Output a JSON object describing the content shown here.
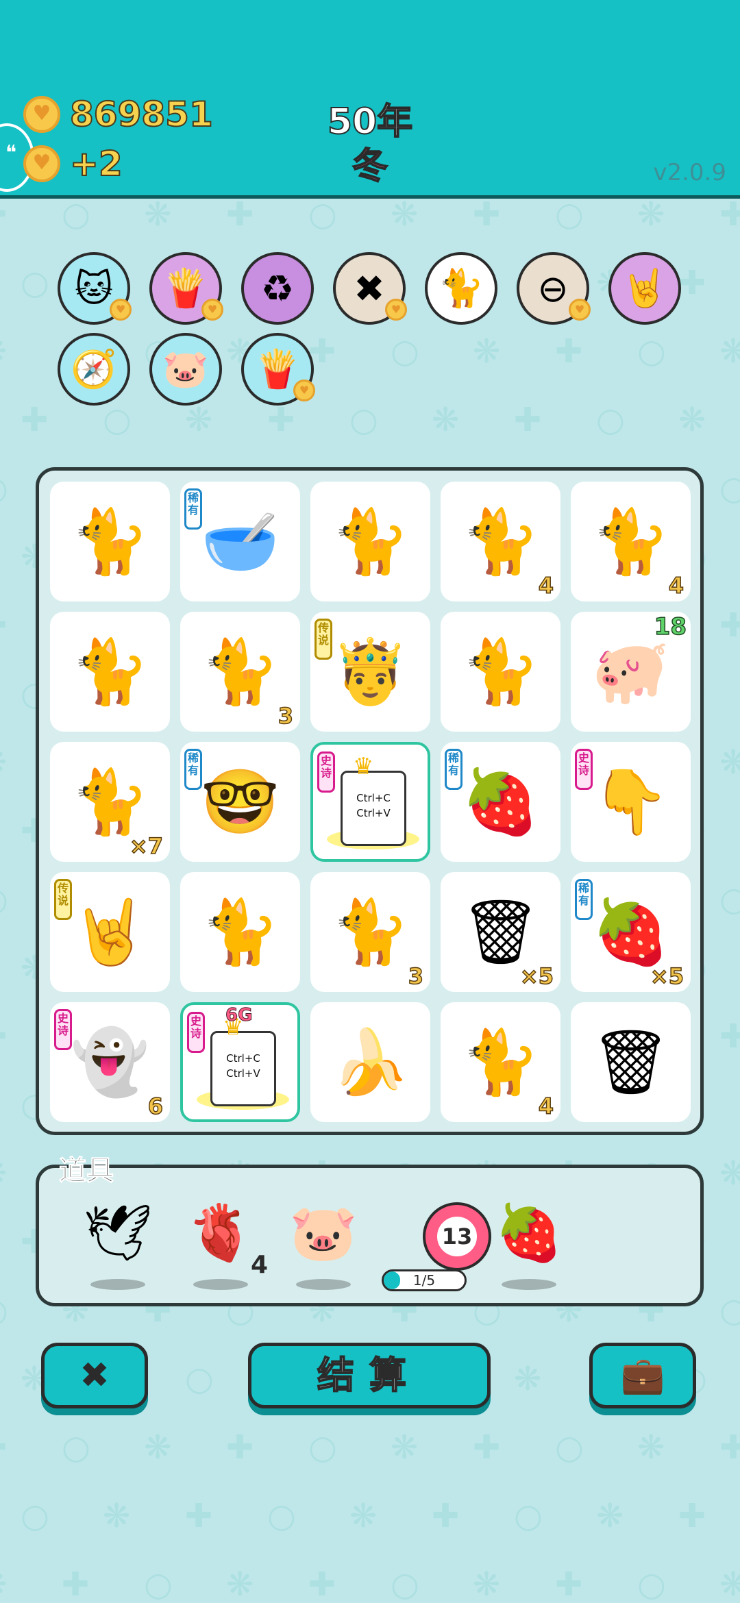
{
  "header": {
    "coins": "869851",
    "income": "+2",
    "year": "50年",
    "season": "冬",
    "version": "v2.0.9"
  },
  "skills": [
    {
      "icon": "cat-hole-icon",
      "glyph": "🐱",
      "bg": "#a6e9f2"
    },
    {
      "icon": "fries-icon",
      "glyph": "🍟",
      "bg": "#d9a3e6"
    },
    {
      "icon": "recycle-icon",
      "glyph": "♻",
      "bg": "#c88ee0"
    },
    {
      "icon": "delete-tag-icon",
      "glyph": "✖",
      "bg": "#eadfcf"
    },
    {
      "icon": "two-cats-icon",
      "glyph": "🐈",
      "bg": "#ffffff"
    },
    {
      "icon": "minus-icon",
      "glyph": "⊖",
      "bg": "#eadfcf"
    },
    {
      "icon": "rock-hand-icon",
      "glyph": "🤘",
      "bg": "#d9a3e6"
    },
    {
      "icon": "compass-icon",
      "glyph": "🧭",
      "bg": "#a6e9f2"
    },
    {
      "icon": "piggy-bank-icon",
      "glyph": "🐷",
      "bg": "#a6e9f2"
    },
    {
      "icon": "fries-icon",
      "glyph": "🍟",
      "bg": "#a6e9f2"
    }
  ],
  "board": [
    {
      "icon": "cat-icon",
      "glyph": "🐈",
      "count": ""
    },
    {
      "icon": "capsule-bowl-icon",
      "glyph": "🥣",
      "tag": "稀有",
      "tag_type": "rare",
      "count": ""
    },
    {
      "icon": "cat-icon",
      "glyph": "🐈",
      "count": ""
    },
    {
      "icon": "cat-icon",
      "glyph": "🐈",
      "count": "4"
    },
    {
      "icon": "cat-icon",
      "glyph": "🐈",
      "count": "4"
    },
    {
      "icon": "cat-icon",
      "glyph": "🐈",
      "count": ""
    },
    {
      "icon": "cat-icon",
      "glyph": "🐈",
      "count": "3"
    },
    {
      "icon": "king-face-icon",
      "glyph": "🤴",
      "tag": "传说",
      "tag_type": "legend",
      "count": ""
    },
    {
      "icon": "cat-icon",
      "glyph": "🐈",
      "count": ""
    },
    {
      "icon": "pig-icon",
      "glyph": "🐖",
      "count": "",
      "topcount": "18"
    },
    {
      "icon": "cat-icon",
      "glyph": "🐈",
      "count": "×7"
    },
    {
      "icon": "nerd-face-icon",
      "glyph": "🤓",
      "tag": "稀有",
      "tag_type": "rare",
      "count": ""
    },
    {
      "icon": "copy-paste-card-icon",
      "card": true,
      "tag": "史诗",
      "tag_type": "epic",
      "line1": "Ctrl+C",
      "line2": "Ctrl+V",
      "highlight": true,
      "count": ""
    },
    {
      "icon": "sleeping-lychee-icon",
      "glyph": "🍓",
      "tag": "稀有",
      "tag_type": "rare",
      "count": ""
    },
    {
      "icon": "pointing-hand-icon",
      "glyph": "👇",
      "tag": "史诗",
      "tag_type": "epic",
      "count": ""
    },
    {
      "icon": "rock-hand-icon",
      "glyph": "🤘",
      "tag": "传说",
      "tag_type": "legend",
      "count": ""
    },
    {
      "icon": "cat-icon",
      "glyph": "🐈",
      "count": ""
    },
    {
      "icon": "cat-icon",
      "glyph": "🐈",
      "count": "3"
    },
    {
      "icon": "garbage-bag-icon",
      "glyph": "🗑",
      "count": "×5"
    },
    {
      "icon": "lychee-icon",
      "glyph": "🍓",
      "tag": "稀有",
      "tag_type": "rare",
      "count": "×5"
    },
    {
      "icon": "ghost-icon",
      "glyph": "👻",
      "tag": "史诗",
      "tag_type": "epic",
      "count": "6"
    },
    {
      "icon": "copy-paste-card-icon",
      "card": true,
      "tag": "史诗",
      "tag_type": "epic",
      "line1": "Ctrl+C",
      "line2": "Ctrl+V",
      "highlight": true,
      "badge": "6G",
      "count": ""
    },
    {
      "icon": "banana-icon",
      "glyph": "🍌",
      "count": ""
    },
    {
      "icon": "cat-icon",
      "glyph": "🐈",
      "count": "4"
    },
    {
      "icon": "garbage-bag-icon",
      "glyph": "🗑",
      "count": ""
    }
  ],
  "items_panel": {
    "title": "道具",
    "items": [
      {
        "icon": "dove-icon",
        "glyph": "🕊",
        "count": ""
      },
      {
        "icon": "liver-icon",
        "glyph": "🫀",
        "count": "4"
      },
      {
        "icon": "piggy-bank-icon",
        "glyph": "🐷",
        "count": ""
      },
      {
        "icon": "lychee-icon",
        "glyph": "🍓",
        "count": ""
      }
    ],
    "target": {
      "value": "13",
      "progress_label": "1/5",
      "progress": 0.2
    }
  },
  "buttons": {
    "delete_icon": "delete-tag-icon",
    "settle_label": "结算",
    "bag_icon": "briefcase-icon"
  },
  "colors": {
    "header": "#15c1c5",
    "background": "#bfe7ea",
    "coin": "#f7c84a",
    "highlight": "#2ec5a0"
  }
}
